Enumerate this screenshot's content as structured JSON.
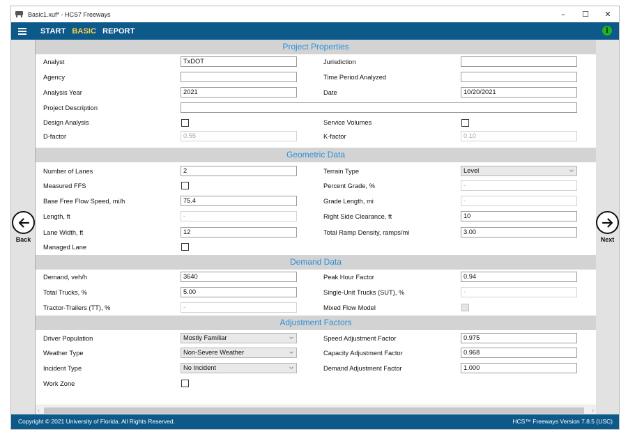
{
  "window": {
    "title": "Basic1.xuf* - HCS7 Freeways"
  },
  "menu": {
    "items": [
      "START",
      "BASIC",
      "REPORT"
    ],
    "active": "BASIC"
  },
  "nav": {
    "back_label": "Back",
    "next_label": "Next"
  },
  "sections": {
    "project": "Project Properties",
    "geometric": "Geometric Data",
    "demand": "Demand Data",
    "adjustment": "Adjustment Factors"
  },
  "project": {
    "analyst": {
      "label": "Analyst",
      "value": "TxDOT"
    },
    "agency": {
      "label": "Agency",
      "value": ""
    },
    "analysis_year": {
      "label": "Analysis Year",
      "value": "2021"
    },
    "project_description": {
      "label": "Project Description",
      "value": ""
    },
    "design_analysis": {
      "label": "Design Analysis",
      "checked": false
    },
    "d_factor": {
      "label": "D-factor",
      "value": "0.55"
    },
    "jurisdiction": {
      "label": "Jurisdiction",
      "value": ""
    },
    "time_period": {
      "label": "Time Period Analyzed",
      "value": ""
    },
    "date": {
      "label": "Date",
      "value": "10/20/2021"
    },
    "service_volumes": {
      "label": "Service Volumes",
      "checked": false
    },
    "k_factor": {
      "label": "K-factor",
      "value": "0.10"
    }
  },
  "geometric": {
    "number_of_lanes": {
      "label": "Number of Lanes",
      "value": "2"
    },
    "measured_ffs": {
      "label": "Measured FFS",
      "checked": false
    },
    "base_ffs": {
      "label": "Base Free Flow Speed, mi/h",
      "value": "75.4"
    },
    "length": {
      "label": "Length, ft",
      "value": "-"
    },
    "lane_width": {
      "label": "Lane Width, ft",
      "value": "12"
    },
    "managed_lane": {
      "label": "Managed Lane",
      "checked": false
    },
    "terrain_type": {
      "label": "Terrain Type",
      "value": "Level"
    },
    "percent_grade": {
      "label": "Percent Grade, %",
      "value": "-"
    },
    "grade_length": {
      "label": "Grade Length, mi",
      "value": "-"
    },
    "right_side_clearance": {
      "label": "Right Side Clearance, ft",
      "value": "10"
    },
    "total_ramp_density": {
      "label": "Total Ramp Density, ramps/mi",
      "value": "3.00"
    }
  },
  "demand": {
    "demand": {
      "label": "Demand, veh/h",
      "value": "3640"
    },
    "total_trucks": {
      "label": "Total Trucks, %",
      "value": "5.00"
    },
    "tractor_trailers": {
      "label": "Tractor-Trailers (TT), %",
      "value": "-"
    },
    "peak_hour_factor": {
      "label": "Peak Hour Factor",
      "value": "0.94"
    },
    "sut": {
      "label": "Single-Unit Trucks (SUT), %",
      "value": "-"
    },
    "mixed_flow_model": {
      "label": "Mixed Flow Model",
      "checked": false
    }
  },
  "adjustment": {
    "driver_population": {
      "label": "Driver Population",
      "value": "Mostly Familiar"
    },
    "weather_type": {
      "label": "Weather Type",
      "value": "Non-Severe Weather"
    },
    "incident_type": {
      "label": "Incident Type",
      "value": "No Incident"
    },
    "work_zone": {
      "label": "Work Zone",
      "checked": false
    },
    "speed_adj": {
      "label": "Speed Adjustment Factor",
      "value": "0.975"
    },
    "capacity_adj": {
      "label": "Capacity Adjustment Factor",
      "value": "0.968"
    },
    "demand_adj": {
      "label": "Demand Adjustment Factor",
      "value": "1.000"
    }
  },
  "status": {
    "copyright": "Copyright © 2021 University of Florida. All Rights Reserved.",
    "version": "HCS™ Freeways Version 7.8.5 (USC)"
  },
  "colors": {
    "accent_bar": "#0d5a8a",
    "section_text": "#2b8fd6",
    "active_menu": "#ffd24a",
    "info_icon": "#21b321"
  },
  "icons": [
    "app-icon",
    "hamburger-icon",
    "info-icon",
    "back-arrow-icon",
    "next-arrow-icon",
    "chevron-down-icon"
  ]
}
